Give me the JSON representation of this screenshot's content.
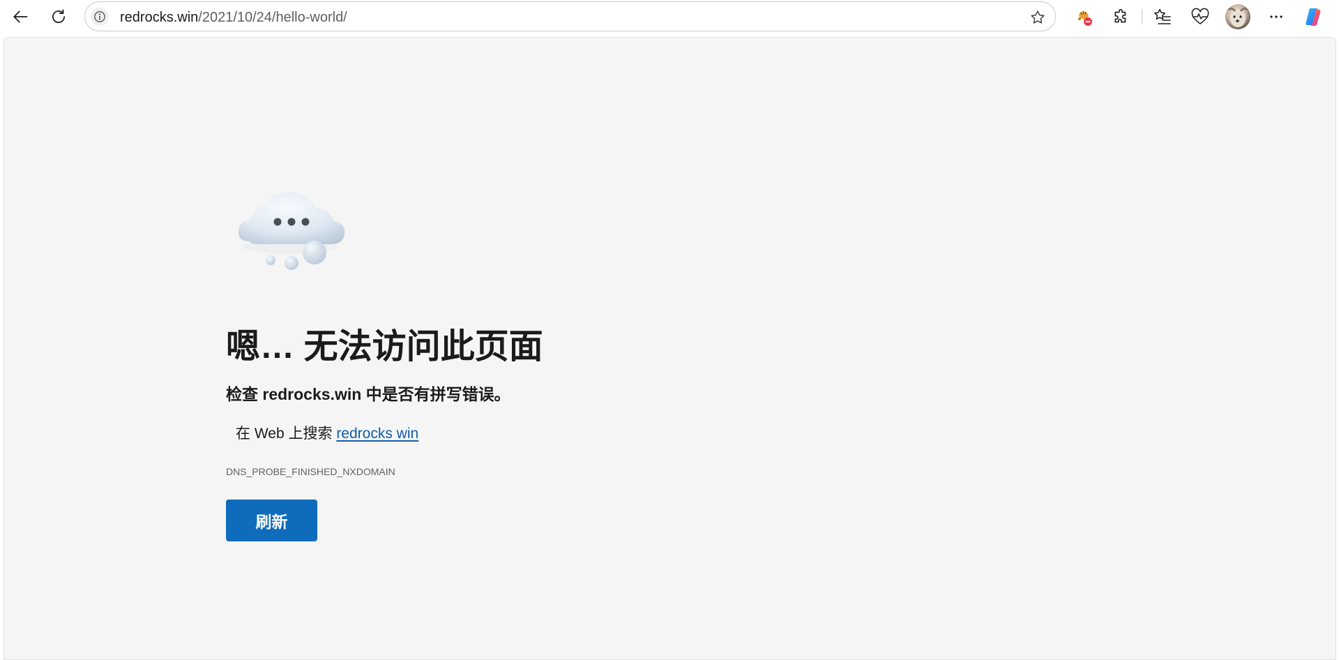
{
  "browser": {
    "url_host": "redrocks.win",
    "url_path": "/2021/10/24/hello-world/"
  },
  "toolbar": {
    "icons": [
      "back-arrow-icon",
      "refresh-icon",
      "site-info-icon",
      "favorite-star-icon",
      "tracking-prevention-icon",
      "extensions-icon",
      "favorites-icon",
      "browser-essentials-icon",
      "profile-avatar",
      "more-menu-icon",
      "copilot-icon"
    ]
  },
  "error_page": {
    "title": "嗯… 无法访问此页面",
    "subtitle": "检查 redrocks.win 中是否有拼写错误。",
    "search_prefix": "在 Web 上搜索 ",
    "search_link": "redrocks win",
    "error_code": "DNS_PROBE_FINISHED_NXDOMAIN",
    "refresh_label": "刷新"
  },
  "colors": {
    "page_background": "#f5f5f5",
    "accent_button": "#0f6cbd",
    "link": "#0f5ea8"
  }
}
